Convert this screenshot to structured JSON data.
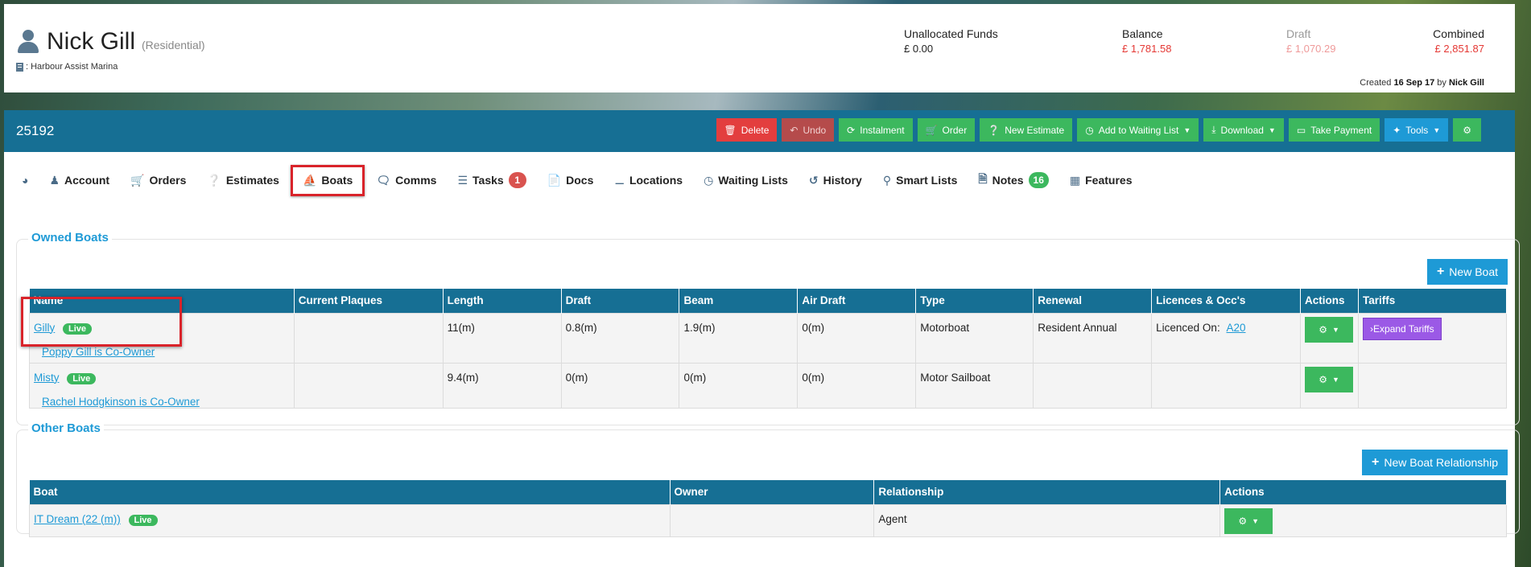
{
  "customer": {
    "name": "Nick Gill",
    "type": "(Residential)",
    "site": ": Harbour Assist Marina",
    "funds": {
      "unallocated_label": "Unallocated Funds",
      "unallocated_value": "£ 0.00",
      "balance_label": "Balance",
      "balance_value": "£ 1,781.58",
      "draft_label": "Draft",
      "draft_value": "£ 1,070.29",
      "combined_label": "Combined",
      "combined_value": "£ 2,851.87"
    },
    "created_prefix": "Created",
    "created_date": "16 Sep 17",
    "created_by_word": "by",
    "created_by": "Nick Gill"
  },
  "panel": {
    "id": "25192",
    "toolbar": [
      {
        "label": "Delete",
        "icon": "trash-icon",
        "color": "#e33e3e"
      },
      {
        "label": "Undo",
        "icon": "undo-icon",
        "color": "#b54b4b"
      },
      {
        "label": "Instalment",
        "icon": "repeat-icon",
        "color": "#3cb85e"
      },
      {
        "label": "Order",
        "icon": "cart-icon",
        "color": "#3cb85e"
      },
      {
        "label": "New Estimate",
        "icon": "question-icon",
        "color": "#3cb85e"
      },
      {
        "label": "Add to Waiting List",
        "icon": "clock-icon",
        "color": "#3cb85e",
        "dropdown": true
      },
      {
        "label": "Download",
        "icon": "download-icon",
        "color": "#3cb85e",
        "dropdown": true
      },
      {
        "label": "Take Payment",
        "icon": "card-icon",
        "color": "#3cb85e"
      },
      {
        "label": "Tools",
        "icon": "wand-icon",
        "color": "#1e9ad6",
        "dropdown": true
      },
      {
        "label": "",
        "icon": "gear-icon",
        "color": "#3cb85e"
      }
    ]
  },
  "tabs": [
    {
      "label": "",
      "icon": "dashboard-icon"
    },
    {
      "label": "Account",
      "icon": "user-icon"
    },
    {
      "label": "Orders",
      "icon": "cart-icon"
    },
    {
      "label": "Estimates",
      "icon": "question-icon"
    },
    {
      "label": "Boats",
      "icon": "ship-icon",
      "active": true
    },
    {
      "label": "Comms",
      "icon": "comments-icon"
    },
    {
      "label": "Tasks",
      "icon": "tasks-icon",
      "badge": "1",
      "badge_color": "red"
    },
    {
      "label": "Docs",
      "icon": "document-icon"
    },
    {
      "label": "Locations",
      "icon": "bed-icon"
    },
    {
      "label": "Waiting Lists",
      "icon": "clock-icon"
    },
    {
      "label": "History",
      "icon": "history-icon"
    },
    {
      "label": "Smart Lists",
      "icon": "lightbulb-icon"
    },
    {
      "label": "Notes",
      "icon": "note-icon",
      "badge": "16",
      "badge_color": "green"
    },
    {
      "label": "Features",
      "icon": "grid-icon"
    }
  ],
  "owned_boats": {
    "title": "Owned Boats",
    "new_button": "New Boat",
    "columns": [
      "Name",
      "Current Plaques",
      "Length",
      "Draft",
      "Beam",
      "Air Draft",
      "Type",
      "Renewal",
      "Licences & Occ's",
      "Actions",
      "Tariffs"
    ],
    "rows": [
      {
        "name": "Gilly",
        "status": "Live",
        "coowner": "Poppy Gill is Co-Owner",
        "plaques": "",
        "length": "11(m)",
        "draft": "0.8(m)",
        "beam": "1.9(m)",
        "air_draft": "0(m)",
        "type": "Motorboat",
        "renewal": "Resident Annual",
        "licence_text": "Licenced On:",
        "licence_link": "A20",
        "tariff_button": "Expand Tariffs"
      },
      {
        "name": "Misty",
        "status": "Live",
        "coowner": "Rachel Hodgkinson is Co-Owner",
        "plaques": "",
        "length": "9.4(m)",
        "draft": "0(m)",
        "beam": "0(m)",
        "air_draft": "0(m)",
        "type": "Motor Sailboat",
        "renewal": "",
        "licence_text": "",
        "licence_link": "",
        "tariff_button": ""
      }
    ]
  },
  "other_boats": {
    "title": "Other Boats",
    "new_button": "New Boat Relationship",
    "columns": [
      "Boat",
      "Owner",
      "Relationship",
      "Actions"
    ],
    "rows": [
      {
        "boat": "IT Dream (22 (m))",
        "status": "Live",
        "owner": "",
        "relationship": "Agent"
      }
    ]
  },
  "colors": {
    "brand_blue": "#166f94",
    "accent_blue": "#1e9ad6",
    "green": "#3cb85e",
    "red": "#e33e3e",
    "purple": "#9b59e6",
    "highlight_red": "#d9232a"
  }
}
